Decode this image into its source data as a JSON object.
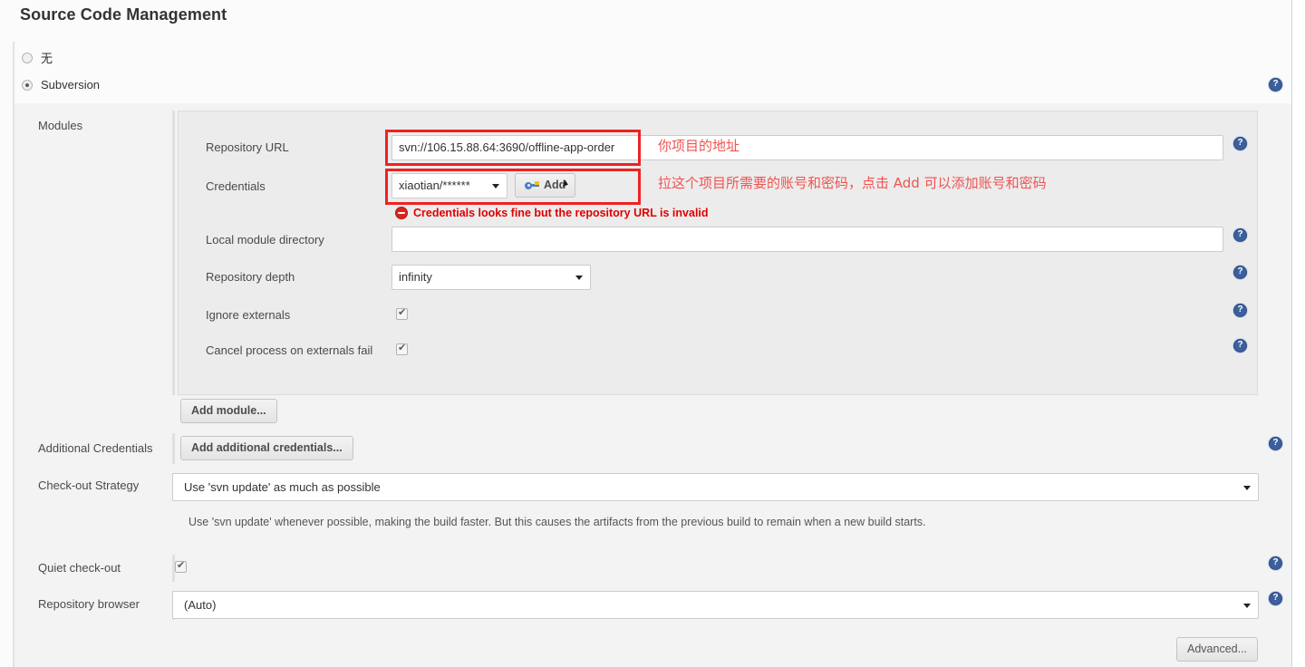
{
  "page": {
    "title": "Source Code Management"
  },
  "scm_options": [
    {
      "label": "无",
      "selected": false,
      "name": "scm-option-none"
    },
    {
      "label": "Subversion",
      "selected": true,
      "name": "scm-option-subversion"
    }
  ],
  "modules": {
    "label": "Modules",
    "repository_url": {
      "label": "Repository URL",
      "value": "svn://106.15.88.64:3690/offline-app-order",
      "placeholder": ""
    },
    "credentials": {
      "label": "Credentials",
      "value": "xiaotian/******",
      "add_button": "Add"
    },
    "error": {
      "text": "Credentials looks fine but the repository URL is invalid",
      "icon": "error-minus-icon"
    },
    "local_module_directory": {
      "label": "Local module directory",
      "value": "",
      "placeholder": ""
    },
    "repository_depth": {
      "label": "Repository depth",
      "value": "infinity"
    },
    "ignore_externals": {
      "label": "Ignore externals",
      "checked": true
    },
    "cancel_process_on_externals_fail": {
      "label": "Cancel process on externals fail",
      "checked": true
    },
    "add_module_button": "Add module..."
  },
  "additional_credentials": {
    "label": "Additional Credentials",
    "button": "Add additional credentials..."
  },
  "checkout_strategy": {
    "label": "Check-out Strategy",
    "value": "Use 'svn update' as much as possible",
    "description": "Use 'svn update' whenever possible, making the build faster. But this causes the artifacts from the previous build to remain when a new build starts."
  },
  "quiet_checkout": {
    "label": "Quiet check-out",
    "checked": true
  },
  "repository_browser": {
    "label": "Repository browser",
    "value": "(Auto)"
  },
  "advanced_button": "Advanced...",
  "help_icon_glyph": "?",
  "annotations": [
    {
      "text": "你项目的地址",
      "name": "annotation-repository-url"
    },
    {
      "text": "拉这个项目所需要的账号和密码，点击 Add 可以添加账号和密码",
      "name": "annotation-credentials"
    }
  ],
  "colors": {
    "annotation_red": "#ef5350",
    "annotation_box": "#ee2222",
    "error_red": "#e00000",
    "help_blue": "#3c5f9e"
  }
}
